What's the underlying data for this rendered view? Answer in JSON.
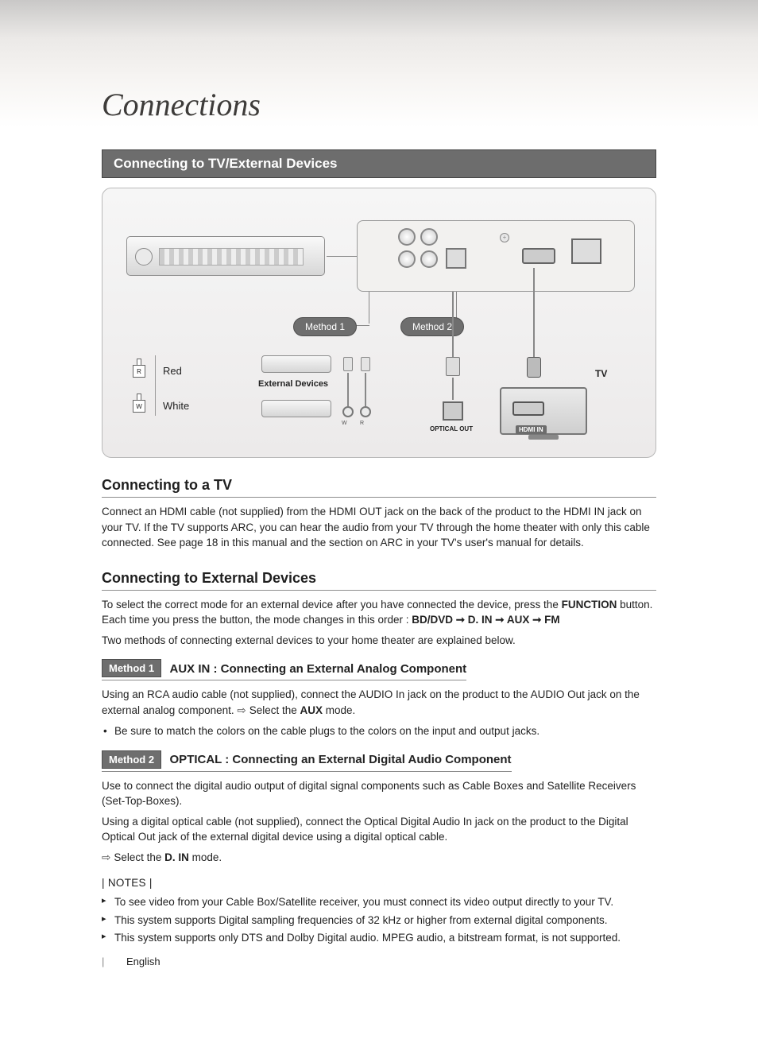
{
  "page_title": "Connections",
  "section_bar": "Connecting to TV/External Devices",
  "diagram": {
    "method1_pill": "Method 1",
    "method2_pill": "Method 2",
    "legend_red": "Red",
    "legend_white": "White",
    "legend_r_char": "R",
    "legend_w_char": "W",
    "external_devices": "External Devices",
    "optical_out": "OPTICAL OUT",
    "hdmi_in": "HDMI IN",
    "tv": "TV",
    "rca_w": "W",
    "rca_r": "R",
    "screw": "+"
  },
  "sec_tv": {
    "heading": "Connecting to a TV",
    "para": "Connect an HDMI cable (not supplied) from the HDMI OUT jack on the back of the product to the HDMI IN jack on your TV. If the TV supports ARC, you can hear the audio from your TV through  the home theater with only this cable connected. See page 18 in this manual and the section on ARC in your TV's user's manual for details."
  },
  "sec_ext": {
    "heading": "Connecting to External Devices",
    "p1_pre": "To select the correct mode for an external device after you have connected the device, press the ",
    "p1_bold": "FUNCTION",
    "p1_post": " button. Each time you press the button, the mode changes in this order : ",
    "p1_chain": "BD/DVD ➞ D. IN ➞ AUX ➞ FM",
    "p2": "Two methods of connecting external devices to your home theater are explained below."
  },
  "m1": {
    "chip": "Method 1",
    "title": "AUX IN : Connecting an External Analog Component",
    "p1_pre": "Using an RCA audio cable (not supplied), connect the AUDIO In jack on the product to the AUDIO Out jack on the external analog component. ",
    "p1_arrow": "Select the ",
    "p1_bold": "AUX",
    "p1_post": " mode.",
    "bullet": "Be sure to match the colors on the cable plugs to the colors on the input and output jacks."
  },
  "m2": {
    "chip": "Method 2",
    "title": "OPTICAL : Connecting an External Digital Audio Component",
    "p1": "Use to connect the digital audio output of digital signal components such as Cable Boxes and Satellite Receivers (Set-Top-Boxes).",
    "p2": "Using a digital optical cable (not supplied), connect the Optical Digital Audio In jack on the product to the Digital Optical Out jack of the external digital device using a digital optical cable.",
    "p3_arrow": "Select the ",
    "p3_bold": "D. IN",
    "p3_post": " mode."
  },
  "notes": {
    "head": "| NOTES |",
    "items": [
      "To see video from your Cable Box/Satellite receiver, you must connect its video output directly to your TV.",
      "This system supports Digital sampling frequencies of 32 kHz or higher from external digital components.",
      "This system supports only DTS and Dolby Digital audio. MPEG audio, a bitstream format, is not supported."
    ]
  },
  "footer": {
    "lang": "English"
  }
}
